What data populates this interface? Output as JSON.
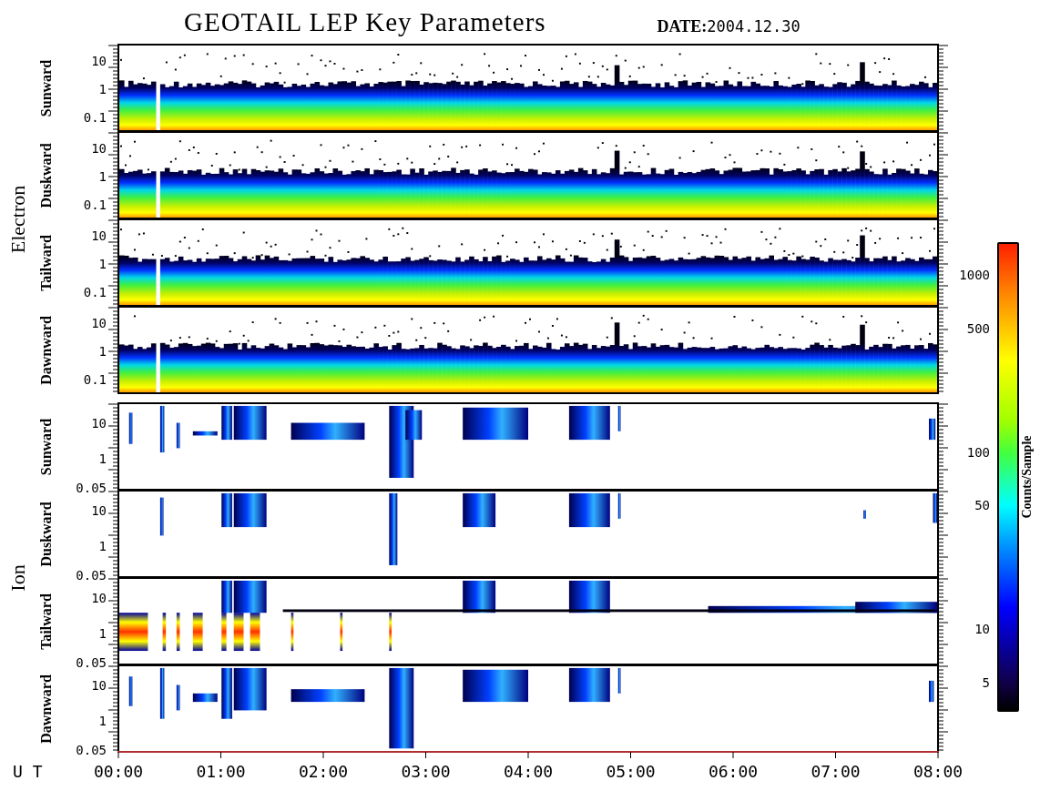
{
  "title": "GEOTAIL LEP Key Parameters",
  "date_label": "DATE:",
  "date": "2004.12.30",
  "groups": [
    {
      "label": "Electron",
      "kind": "electron",
      "panels": [
        {
          "label": "Sunward",
          "yticks": [
            "10",
            "1",
            "0.1"
          ]
        },
        {
          "label": "Duskward",
          "yticks": [
            "10",
            "1",
            "0.1"
          ]
        },
        {
          "label": "Tailward",
          "yticks": [
            "10",
            "1",
            "0.1"
          ]
        },
        {
          "label": "Dawnward",
          "yticks": [
            "10",
            "1",
            "0.1"
          ]
        }
      ]
    },
    {
      "label": "Ion",
      "kind": "ion",
      "panels": [
        {
          "label": "Sunward",
          "yticks": [
            "10",
            "1",
            "0.05"
          ]
        },
        {
          "label": "Duskward",
          "yticks": [
            "10",
            "1",
            "0.05"
          ]
        },
        {
          "label": "Tailward",
          "yticks": [
            "10",
            "1",
            "0.05"
          ]
        },
        {
          "label": "Dawnward",
          "yticks": [
            "10",
            "1",
            "0.05"
          ]
        }
      ]
    }
  ],
  "time_axis": {
    "label": "U T",
    "ticks": [
      "00:00",
      "01:00",
      "02:00",
      "03:00",
      "04:00",
      "05:00",
      "06:00",
      "07:00",
      "08:00"
    ]
  },
  "colorbar": {
    "label": "Counts/Sample",
    "ticks": [
      "1000",
      "500",
      "100",
      "50",
      "10",
      "5"
    ]
  }
}
